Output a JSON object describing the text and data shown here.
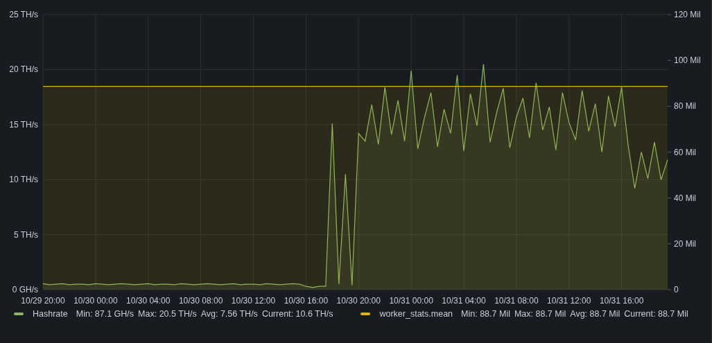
{
  "panel": {
    "chart_data": {
      "type": "area",
      "grid": true,
      "ylim": [
        0,
        25
      ],
      "y2lim": [
        0,
        120
      ],
      "categories": [
        "10/29 20:00",
        null,
        null,
        null,
        null,
        null,
        null,
        null,
        "10/30 00:00",
        null,
        null,
        null,
        null,
        null,
        null,
        null,
        "10/30 04:00",
        null,
        null,
        null,
        null,
        null,
        null,
        null,
        "10/30 08:00",
        null,
        null,
        null,
        null,
        null,
        null,
        null,
        "10/30 12:00",
        null,
        null,
        null,
        null,
        null,
        null,
        null,
        "10/30 16:00",
        null,
        null,
        null,
        null,
        null,
        null,
        null,
        "10/30 20:00",
        null,
        null,
        null,
        null,
        null,
        null,
        null,
        "10/31 00:00",
        null,
        null,
        null,
        null,
        null,
        null,
        null,
        "10/31 04:00",
        null,
        null,
        null,
        null,
        null,
        null,
        null,
        "10/31 08:00",
        null,
        null,
        null,
        null,
        null,
        null,
        null,
        "10/31 12:00",
        null,
        null,
        null,
        null,
        null,
        null,
        null,
        "10/31 16:00",
        null,
        null,
        null,
        null,
        null,
        null,
        null
      ],
      "yticks": [
        {
          "value": 0,
          "label": "0 GH/s"
        },
        {
          "value": 5,
          "label": "5 TH/s"
        },
        {
          "value": 10,
          "label": "10 TH/s"
        },
        {
          "value": 15,
          "label": "15 TH/s"
        },
        {
          "value": 20,
          "label": "20 TH/s"
        },
        {
          "value": 25,
          "label": "25 TH/s"
        }
      ],
      "y2ticks": [
        {
          "value": 0,
          "label": "0"
        },
        {
          "value": 20,
          "label": "20 Mil"
        },
        {
          "value": 40,
          "label": "40 Mil"
        },
        {
          "value": 60,
          "label": "60 Mil"
        },
        {
          "value": 80,
          "label": "80 Mil"
        },
        {
          "value": 100,
          "label": "100 Mil"
        },
        {
          "value": 120,
          "label": "120 Mil"
        }
      ],
      "series": [
        {
          "name": "Hashrate",
          "color": "#8ab661",
          "values": [
            0.55,
            0.45,
            0.5,
            0.55,
            0.45,
            0.5,
            0.5,
            0.45,
            0.55,
            0.5,
            0.45,
            0.5,
            0.55,
            0.5,
            0.45,
            0.5,
            0.55,
            0.45,
            0.5,
            0.5,
            0.45,
            0.55,
            0.5,
            0.45,
            0.5,
            0.55,
            0.5,
            0.45,
            0.5,
            0.55,
            0.45,
            0.5,
            0.5,
            0.45,
            0.55,
            0.5,
            0.45,
            0.5,
            0.55,
            0.5,
            0.3,
            0.2,
            0.3,
            0.3,
            15.1,
            0.5,
            10.5,
            0.4,
            14.2,
            13.5,
            16.8,
            13.2,
            18.4,
            14.1,
            17.2,
            13.5,
            19.9,
            12.8,
            15.6,
            17.9,
            13.0,
            16.4,
            14.2,
            19.5,
            12.6,
            17.8,
            14.9,
            20.5,
            13.4,
            16.1,
            18.3,
            12.9,
            15.7,
            17.4,
            13.8,
            18.8,
            14.5,
            16.6,
            12.7,
            17.9,
            15.2,
            13.6,
            18.1,
            14.4,
            16.9,
            12.5,
            17.6,
            14.8,
            18.4,
            13.1,
            9.2,
            12.5,
            10.1,
            13.4,
            10.0,
            11.8
          ]
        },
        {
          "name": "worker_stats.mean",
          "color": "#e0b400",
          "axis": "y2",
          "values": [
            88.7,
            88.7,
            88.7,
            88.7,
            88.7,
            88.7,
            88.7,
            88.7,
            88.7,
            88.7,
            88.7,
            88.7,
            88.7,
            88.7,
            88.7,
            88.7,
            88.7,
            88.7,
            88.7,
            88.7,
            88.7,
            88.7,
            88.7,
            88.7,
            88.7,
            88.7,
            88.7,
            88.7,
            88.7,
            88.7,
            88.7,
            88.7,
            88.7,
            88.7,
            88.7,
            88.7,
            88.7,
            88.7,
            88.7,
            88.7,
            88.7,
            88.7,
            88.7,
            88.7,
            88.7,
            88.7,
            88.7,
            88.7,
            88.7,
            88.7,
            88.7,
            88.7,
            88.7,
            88.7,
            88.7,
            88.7,
            88.7,
            88.7,
            88.7,
            88.7,
            88.7,
            88.7,
            88.7,
            88.7,
            88.7,
            88.7,
            88.7,
            88.7,
            88.7,
            88.7,
            88.7,
            88.7,
            88.7,
            88.7,
            88.7,
            88.7,
            88.7,
            88.7,
            88.7,
            88.7,
            88.7,
            88.7,
            88.7,
            88.7,
            88.7,
            88.7,
            88.7,
            88.7,
            88.7,
            88.7,
            88.7,
            88.7,
            88.7,
            88.7,
            88.7,
            88.7
          ]
        }
      ]
    },
    "legend": [
      {
        "stats": [
          "Min: 87.1 GH/s",
          "Max: 20.5 TH/s",
          "Avg: 7.56 TH/s",
          "Current: 10.6 TH/s"
        ]
      },
      {
        "stats": [
          "Min: 88.7 Mil",
          "Max: 88.7 Mil",
          "Avg: 88.7 Mil",
          "Current: 88.7 Mil"
        ]
      }
    ]
  }
}
